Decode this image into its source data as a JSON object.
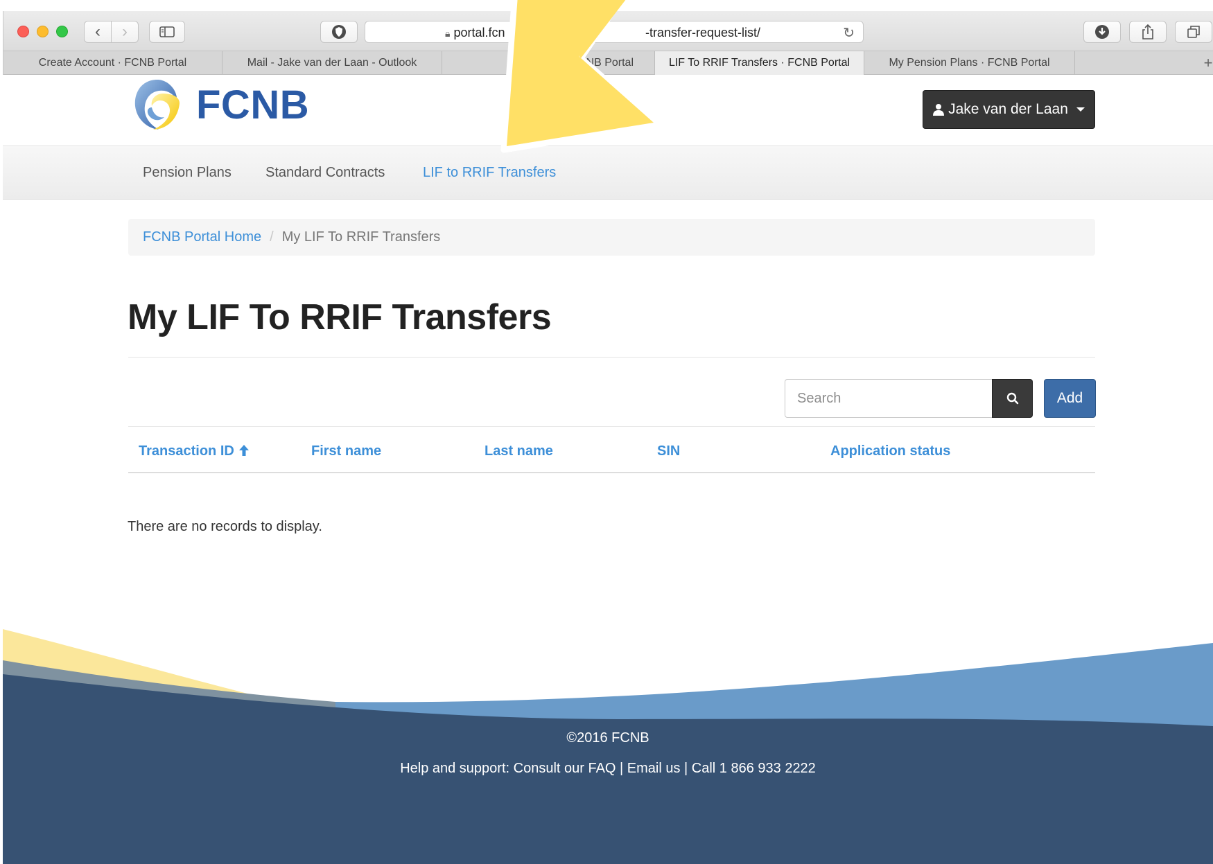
{
  "browser": {
    "url_left": "portal.fcn",
    "url_right": "-transfer-request-list/",
    "tabs": [
      {
        "label": "Create Account  · FCNB Portal"
      },
      {
        "label": "Mail - Jake van der Laan - Outlook"
      },
      {
        "label": "· FCNB Portal"
      },
      {
        "label": "LIF To RRIF Transfers  · FCNB Portal"
      },
      {
        "label": "My Pension Plans  · FCNB Portal"
      }
    ]
  },
  "header": {
    "logo_text": "FCNB",
    "user_label": "Jake van der Laan"
  },
  "nav": {
    "items": [
      {
        "label": "Pension Plans"
      },
      {
        "label": "Standard Contracts"
      },
      {
        "label": "LIF to RRIF Transfers"
      }
    ],
    "active_index": 2
  },
  "breadcrumb": {
    "home": "FCNB Portal Home",
    "separator": "/",
    "current": "My LIF To RRIF Transfers"
  },
  "main": {
    "title": "My LIF To RRIF Transfers",
    "search_placeholder": "Search",
    "add_label": "Add",
    "columns": [
      {
        "label": "Transaction ID"
      },
      {
        "label": "First name"
      },
      {
        "label": "Last name"
      },
      {
        "label": "SIN"
      },
      {
        "label": "Application status"
      }
    ],
    "empty_message": "There are no records to display."
  },
  "footer": {
    "copyright": "©2016 FCNB",
    "support": "Help and support: Consult our FAQ | Email us | Call 1 866 933 2222"
  },
  "colors": {
    "link": "#3d8fd8",
    "brand_blue": "#2b5aa5",
    "footer_navy": "#375273",
    "footer_mid": "#6a9bc9",
    "footer_yellow": "#fbe79b",
    "annotation_yellow": "#ffe066"
  }
}
